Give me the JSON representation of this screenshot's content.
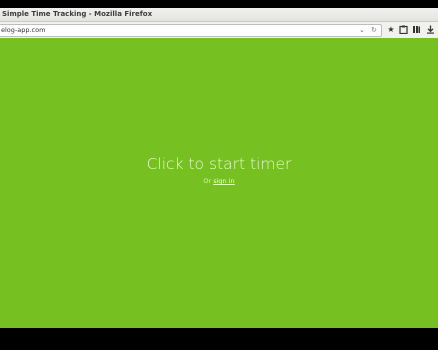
{
  "window": {
    "title": "Simple Time Tracking - Mozilla Firefox"
  },
  "browser": {
    "url": "elog-app.com",
    "icons": [
      "star-icon",
      "clipboard-icon",
      "library-icon",
      "download-icon"
    ]
  },
  "main": {
    "start_label": "Click to start timer",
    "or_label": "Or",
    "signin_label": "sign in"
  },
  "colors": {
    "page_bg": "#76c121"
  }
}
